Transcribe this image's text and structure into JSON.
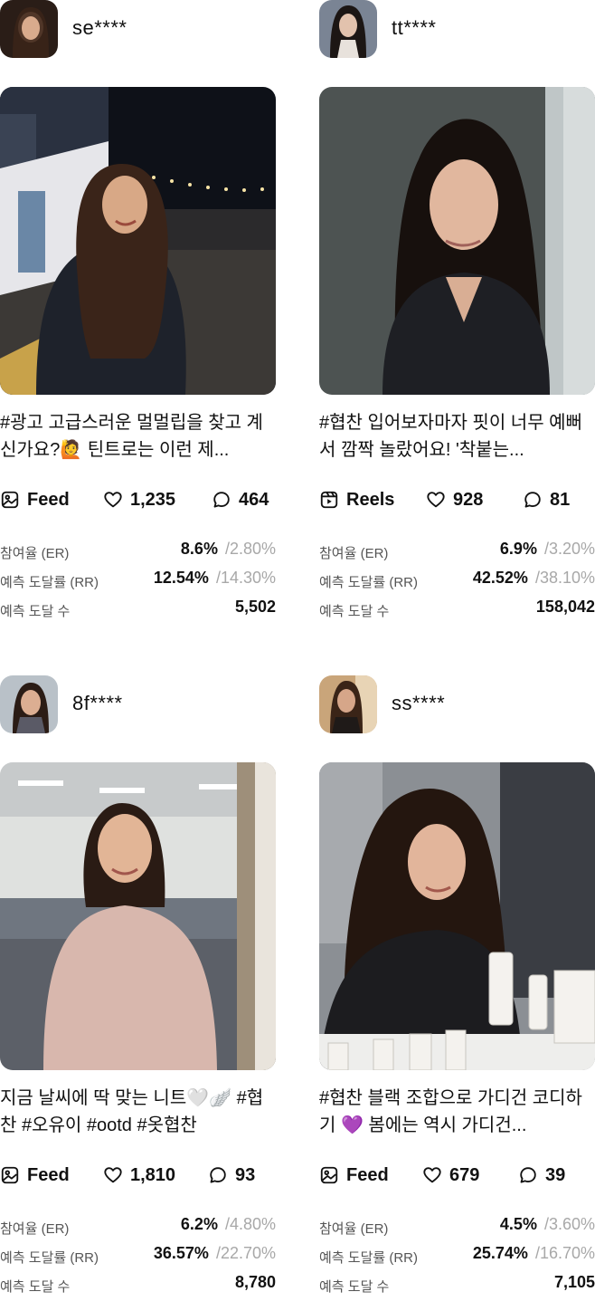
{
  "metric_labels": {
    "er": "참여율 (ER)",
    "rr": "예측 도달률 (RR)",
    "reach": "예측 도달 수"
  },
  "cards": [
    {
      "username": "se****",
      "caption": "#광고 고급스러운 멀멀립을 찾고 계신가요?🙋 틴트로는 이런 제...",
      "type": "Feed",
      "type_icon": "feed-image-icon",
      "likes": "1,235",
      "comments": "464",
      "er": "8.6%",
      "er_avg": "/2.80%",
      "rr": "12.54%",
      "rr_avg": "/14.30%",
      "reach": "5,502"
    },
    {
      "username": "tt****",
      "caption": "#협찬 입어보자마자 핏이 너무 예뻐서 깜짝 놀랐어요! '착붙는...",
      "type": "Reels",
      "type_icon": "reels-icon",
      "likes": "928",
      "comments": "81",
      "er": "6.9%",
      "er_avg": "/3.20%",
      "rr": "42.52%",
      "rr_avg": "/38.10%",
      "reach": "158,042"
    },
    {
      "username": "8f****",
      "caption": "지금 날씨에 딱 맞는 니트🤍🪽 #협찬 #오유이 #ootd #옷협찬",
      "type": "Feed",
      "type_icon": "feed-image-icon",
      "likes": "1,810",
      "comments": "93",
      "er": "6.2%",
      "er_avg": "/4.80%",
      "rr": "36.57%",
      "rr_avg": "/22.70%",
      "reach": "8,780"
    },
    {
      "username": "ss****",
      "caption": "#협찬 블랙 조합으로 가디건 코디하기 💜 봄에는 역시 가디건...",
      "type": "Feed",
      "type_icon": "feed-image-icon",
      "likes": "679",
      "comments": "39",
      "er": "4.5%",
      "er_avg": "/3.60%",
      "rr": "25.74%",
      "rr_avg": "/16.70%",
      "reach": "7,105"
    }
  ],
  "icons": {
    "like": "heart-icon",
    "comment": "comment-bubble-icon"
  }
}
